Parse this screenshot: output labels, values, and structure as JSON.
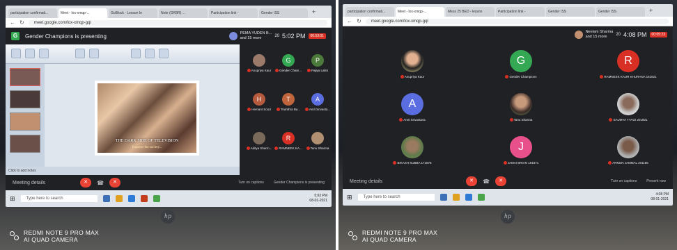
{
  "watermark": {
    "line1": "REDMI NOTE 9 PRO MAX",
    "line2": "AI QUAD CAMERA"
  },
  "left_screen": {
    "tabs": [
      "participation confirmati...",
      "Meet - lox-xmqp-...",
      "GoBlock - Lesson In",
      "Note (GKBR) ...",
      "Participation link -",
      "Gender ISS",
      ""
    ],
    "url": "meet.google.com/lox-xmqp-gqi",
    "presenting_title": "Gender Champions is presenting",
    "presenter_name": "PEMA YUDEN B...",
    "presenter_more": "and 15 more",
    "participant_count": "20",
    "time": "5:02 PM",
    "recording": "00:53:01",
    "slide": {
      "title": "THE DARK SIDE OF TELEVISION",
      "subtitle": "Exposes the society..."
    },
    "ppt_status": "Click to add notes",
    "participants": [
      {
        "initial": "",
        "name": "Anupriya Kaur",
        "color": "#9c7a6a"
      },
      {
        "initial": "G",
        "name": "Gender Cham...",
        "color": "#34a853"
      },
      {
        "initial": "P",
        "name": "Pajiya Lalini",
        "color": "#4c7a3a"
      },
      {
        "initial": "H",
        "name": "Hemant Sood",
        "color": "#b55a3c"
      },
      {
        "initial": "T",
        "name": "Trianthra Ba...",
        "color": "#c0643c"
      },
      {
        "initial": "A",
        "name": "Amit Srivasta...",
        "color": "#5b6ee1"
      },
      {
        "initial": "",
        "name": "Aditya Sharm...",
        "color": "#7a6a5a"
      },
      {
        "initial": "R",
        "name": "RAMNEEK KA...",
        "color": "#d93025"
      },
      {
        "initial": "",
        "name": "Tanu Sharma",
        "color": "#b09070"
      }
    ],
    "meeting_details": "Meeting details",
    "controls_right": [
      "Turn on captions",
      "Gender Champions is presenting"
    ],
    "search_placeholder": "Type here to search",
    "clock": "5:02 PM",
    "date": "08-01-2021"
  },
  "right_screen": {
    "tabs": [
      "participation confirmati...",
      "Meet - lox-xmqp-...",
      "Mess 25 BED - lesson",
      "Participation link -",
      "Gender ISS",
      "Gender ISS"
    ],
    "url": "meet.google.com/lox-xmqp-gqi",
    "host_name": "Neelam Sharma",
    "host_more": "and 15 more",
    "participant_count": "20",
    "time": "4:08 PM",
    "recording": "00:05:23",
    "participants": [
      {
        "initial": "",
        "name": "Anupriya Kaur",
        "style": "photo-av2",
        "color": ""
      },
      {
        "initial": "G",
        "name": "Gender Champions",
        "style": "",
        "color": "#34a853"
      },
      {
        "initial": "R",
        "name": "RAMNEEK KAUR KHURANA 181821",
        "style": "",
        "color": "#d93025"
      },
      {
        "initial": "A",
        "name": "Amit Srivastava",
        "style": "",
        "color": "#5b6ee1"
      },
      {
        "initial": "",
        "name": "Tanu Sharma",
        "style": "photo-av",
        "color": ""
      },
      {
        "initial": "",
        "name": "SAUMYA TYAGI 201801",
        "style": "photo-av3",
        "color": ""
      },
      {
        "initial": "",
        "name": "BIKASH SUBBA 171876",
        "style": "photo-av4",
        "color": ""
      },
      {
        "initial": "J",
        "name": "JAMAI BRIAN 191871",
        "style": "",
        "color": "#e8508c"
      },
      {
        "initial": "",
        "name": "ARNON JAMMAL 201185",
        "style": "photo-av5",
        "color": ""
      }
    ],
    "meeting_details": "Meeting details",
    "controls_right": [
      "Turn on captions",
      "Present now"
    ],
    "search_placeholder": "Type here to search",
    "clock": "4:08 PM",
    "date": "08-01-2021"
  },
  "monitor_logo": "hp"
}
